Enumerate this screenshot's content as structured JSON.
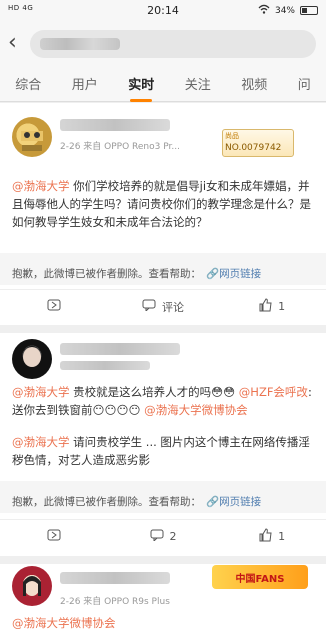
{
  "status": {
    "carrier": "HD 4G",
    "time": "20:14",
    "battery": "34%"
  },
  "tabs": [
    {
      "label": "综合"
    },
    {
      "label": "用户"
    },
    {
      "label": "实时"
    },
    {
      "label": "关注"
    },
    {
      "label": "视频"
    },
    {
      "label": "问"
    }
  ],
  "post1": {
    "meta": "2-26  来自 OPPO Reno3 Pr...",
    "badge_top": "尚品",
    "badge_num": "NO.0079742",
    "text_at": "@渤海大学",
    "text": " 你们学校培养的就是倡导ji女和未成年嫖娼，并且侮辱他人的学生吗？请问贵校你们的教学理念是什么？是如何教导学生妓女和未成年合法论的？",
    "deleted": "抱歉，此微博已被作者删除。查看帮助：",
    "link": "网页链接",
    "comment_label": "评论"
  },
  "post2": {
    "text_a_at": "@渤海大学",
    "text_a": " 贵校就是这么培养人才的吗😳😳 ",
    "text_a_at2": "@HZF会呼改",
    "text_a2": ":送你去到铁窗前😶😶😶😶 ",
    "text_a_at3": "@渤海大学微博协会",
    "text_b_at": "@渤海大学",
    "text_b": " 请问贵校学生 ... 图片内这个博主在网络传播淫秽色情，对艺人造成恶劣影",
    "deleted": "抱歉，此微博已被作者删除。查看帮助：",
    "link": "网页链接",
    "comments": "2",
    "likes": "1"
  },
  "post3": {
    "meta": "2-26  来自 OPPO R9s Plus",
    "text_at": "@渤海大学微博协会",
    "fans_badge": "中国FANS"
  }
}
